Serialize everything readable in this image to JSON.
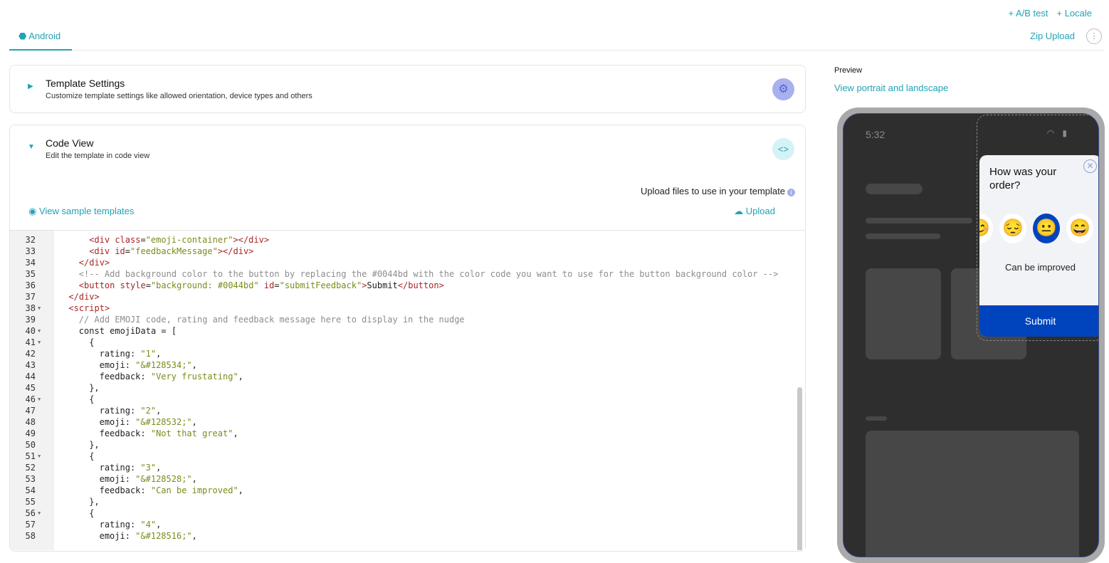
{
  "header": {
    "ab_test": "+ A/B test",
    "locale": "+ Locale",
    "zip_upload": "Zip Upload",
    "more": "⋮"
  },
  "tabs": [
    {
      "label": "Android",
      "icon": "android-icon",
      "active": true
    }
  ],
  "template_settings": {
    "title": "Template Settings",
    "subtitle": "Customize template settings like allowed orientation, device types and others",
    "icon": "gear-icon"
  },
  "code_view": {
    "title": "Code View",
    "subtitle": "Edit the template in code view",
    "icon": "code-icon",
    "upload_hint": "Upload files to use in your template",
    "view_samples": "View sample templates",
    "upload": "Upload",
    "lines": [
      {
        "n": "32",
        "fold": false,
        "indent": 6,
        "tokens": [
          [
            "tag",
            "<div "
          ],
          [
            "attr",
            "class"
          ],
          [
            "txt",
            "="
          ],
          [
            "str",
            "\"emoji-container\""
          ],
          [
            "tag",
            "></div>"
          ]
        ]
      },
      {
        "n": "33",
        "fold": false,
        "indent": 6,
        "tokens": [
          [
            "tag",
            "<div "
          ],
          [
            "attr",
            "id"
          ],
          [
            "txt",
            "="
          ],
          [
            "str",
            "\"feedbackMessage\""
          ],
          [
            "tag",
            "></div>"
          ]
        ]
      },
      {
        "n": "34",
        "fold": false,
        "indent": 4,
        "tokens": [
          [
            "tag",
            "</div>"
          ]
        ]
      },
      {
        "n": "35",
        "fold": false,
        "indent": 4,
        "tokens": [
          [
            "com",
            "<!-- Add background color to the button by replacing the #0044bd with the color code you want to use for the button background color -->"
          ]
        ]
      },
      {
        "n": "36",
        "fold": false,
        "indent": 4,
        "tokens": [
          [
            "tag",
            "<button "
          ],
          [
            "attr",
            "style"
          ],
          [
            "txt",
            "="
          ],
          [
            "str",
            "\"background: #0044bd\""
          ],
          [
            "attr",
            " id"
          ],
          [
            "txt",
            "="
          ],
          [
            "str",
            "\"submitFeedback\""
          ],
          [
            "tag",
            ">"
          ],
          [
            "txt",
            "Submit"
          ],
          [
            "tag",
            "</button>"
          ]
        ]
      },
      {
        "n": "37",
        "fold": false,
        "indent": 2,
        "tokens": [
          [
            "tag",
            "</div>"
          ]
        ]
      },
      {
        "n": "38",
        "fold": true,
        "indent": 2,
        "tokens": [
          [
            "tag",
            "<script>"
          ]
        ]
      },
      {
        "n": "39",
        "fold": false,
        "indent": 4,
        "tokens": [
          [
            "com",
            "// Add EMOJI code, rating and feedback message here to display in the nudge"
          ]
        ]
      },
      {
        "n": "40",
        "fold": true,
        "indent": 4,
        "tokens": [
          [
            "txt",
            "const emojiData = ["
          ]
        ]
      },
      {
        "n": "41",
        "fold": true,
        "indent": 6,
        "tokens": [
          [
            "txt",
            "{"
          ]
        ]
      },
      {
        "n": "42",
        "fold": false,
        "indent": 8,
        "tokens": [
          [
            "txt",
            "rating: "
          ],
          [
            "str",
            "\"1\""
          ],
          [
            "txt",
            ","
          ]
        ]
      },
      {
        "n": "43",
        "fold": false,
        "indent": 8,
        "tokens": [
          [
            "txt",
            "emoji: "
          ],
          [
            "str",
            "\"&#128534;\""
          ],
          [
            "txt",
            ","
          ]
        ]
      },
      {
        "n": "44",
        "fold": false,
        "indent": 8,
        "tokens": [
          [
            "txt",
            "feedback: "
          ],
          [
            "str",
            "\"Very frustating\""
          ],
          [
            "txt",
            ","
          ]
        ]
      },
      {
        "n": "45",
        "fold": false,
        "indent": 6,
        "tokens": [
          [
            "txt",
            "},"
          ]
        ]
      },
      {
        "n": "46",
        "fold": true,
        "indent": 6,
        "tokens": [
          [
            "txt",
            "{"
          ]
        ]
      },
      {
        "n": "47",
        "fold": false,
        "indent": 8,
        "tokens": [
          [
            "txt",
            "rating: "
          ],
          [
            "str",
            "\"2\""
          ],
          [
            "txt",
            ","
          ]
        ]
      },
      {
        "n": "48",
        "fold": false,
        "indent": 8,
        "tokens": [
          [
            "txt",
            "emoji: "
          ],
          [
            "str",
            "\"&#128532;\""
          ],
          [
            "txt",
            ","
          ]
        ]
      },
      {
        "n": "49",
        "fold": false,
        "indent": 8,
        "tokens": [
          [
            "txt",
            "feedback: "
          ],
          [
            "str",
            "\"Not that great\""
          ],
          [
            "txt",
            ","
          ]
        ]
      },
      {
        "n": "50",
        "fold": false,
        "indent": 6,
        "tokens": [
          [
            "txt",
            "},"
          ]
        ]
      },
      {
        "n": "51",
        "fold": true,
        "indent": 6,
        "tokens": [
          [
            "txt",
            "{"
          ]
        ]
      },
      {
        "n": "52",
        "fold": false,
        "indent": 8,
        "tokens": [
          [
            "txt",
            "rating: "
          ],
          [
            "str",
            "\"3\""
          ],
          [
            "txt",
            ","
          ]
        ]
      },
      {
        "n": "53",
        "fold": false,
        "indent": 8,
        "tokens": [
          [
            "txt",
            "emoji: "
          ],
          [
            "str",
            "\"&#128528;\""
          ],
          [
            "txt",
            ","
          ]
        ]
      },
      {
        "n": "54",
        "fold": false,
        "indent": 8,
        "tokens": [
          [
            "txt",
            "feedback: "
          ],
          [
            "str",
            "\"Can be improved\""
          ],
          [
            "txt",
            ","
          ]
        ]
      },
      {
        "n": "55",
        "fold": false,
        "indent": 6,
        "tokens": [
          [
            "txt",
            "},"
          ]
        ]
      },
      {
        "n": "56",
        "fold": true,
        "indent": 6,
        "tokens": [
          [
            "txt",
            "{"
          ]
        ]
      },
      {
        "n": "57",
        "fold": false,
        "indent": 8,
        "tokens": [
          [
            "txt",
            "rating: "
          ],
          [
            "str",
            "\"4\""
          ],
          [
            "txt",
            ","
          ]
        ]
      },
      {
        "n": "58",
        "fold": false,
        "indent": 8,
        "tokens": [
          [
            "txt",
            "emoji: "
          ],
          [
            "str",
            "\"&#128516;\""
          ],
          [
            "txt",
            ","
          ]
        ]
      }
    ]
  },
  "preview": {
    "label": "Preview",
    "view_link": "View portrait and landscape",
    "time": "5:32",
    "nudge": {
      "question": "How was your order?",
      "emojis": [
        "😊",
        "😔",
        "😐",
        "😄",
        "🤩"
      ],
      "selected_index": 2,
      "feedback": "Can be improved",
      "submit": "Submit",
      "button_color": "#0044bd"
    }
  },
  "colors": {
    "accent": "#21a3b5",
    "button": "#0044bd"
  }
}
